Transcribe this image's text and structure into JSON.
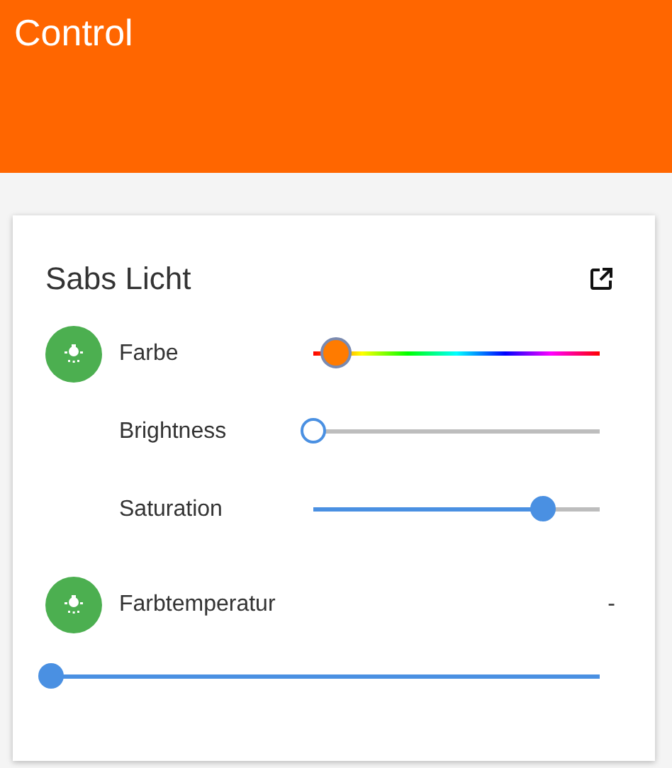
{
  "header": {
    "title": "Control"
  },
  "card": {
    "title": "Sabs Licht",
    "controls": [
      {
        "kind": "hue",
        "label": "Farbe",
        "level": 0.08
      },
      {
        "kind": "slider",
        "label": "Brightness",
        "level": 0
      },
      {
        "kind": "slider",
        "label": "Saturation",
        "level": 0.8
      }
    ],
    "temperature": {
      "label": "Farbtemperatur",
      "value": "-",
      "level": 0
    }
  }
}
